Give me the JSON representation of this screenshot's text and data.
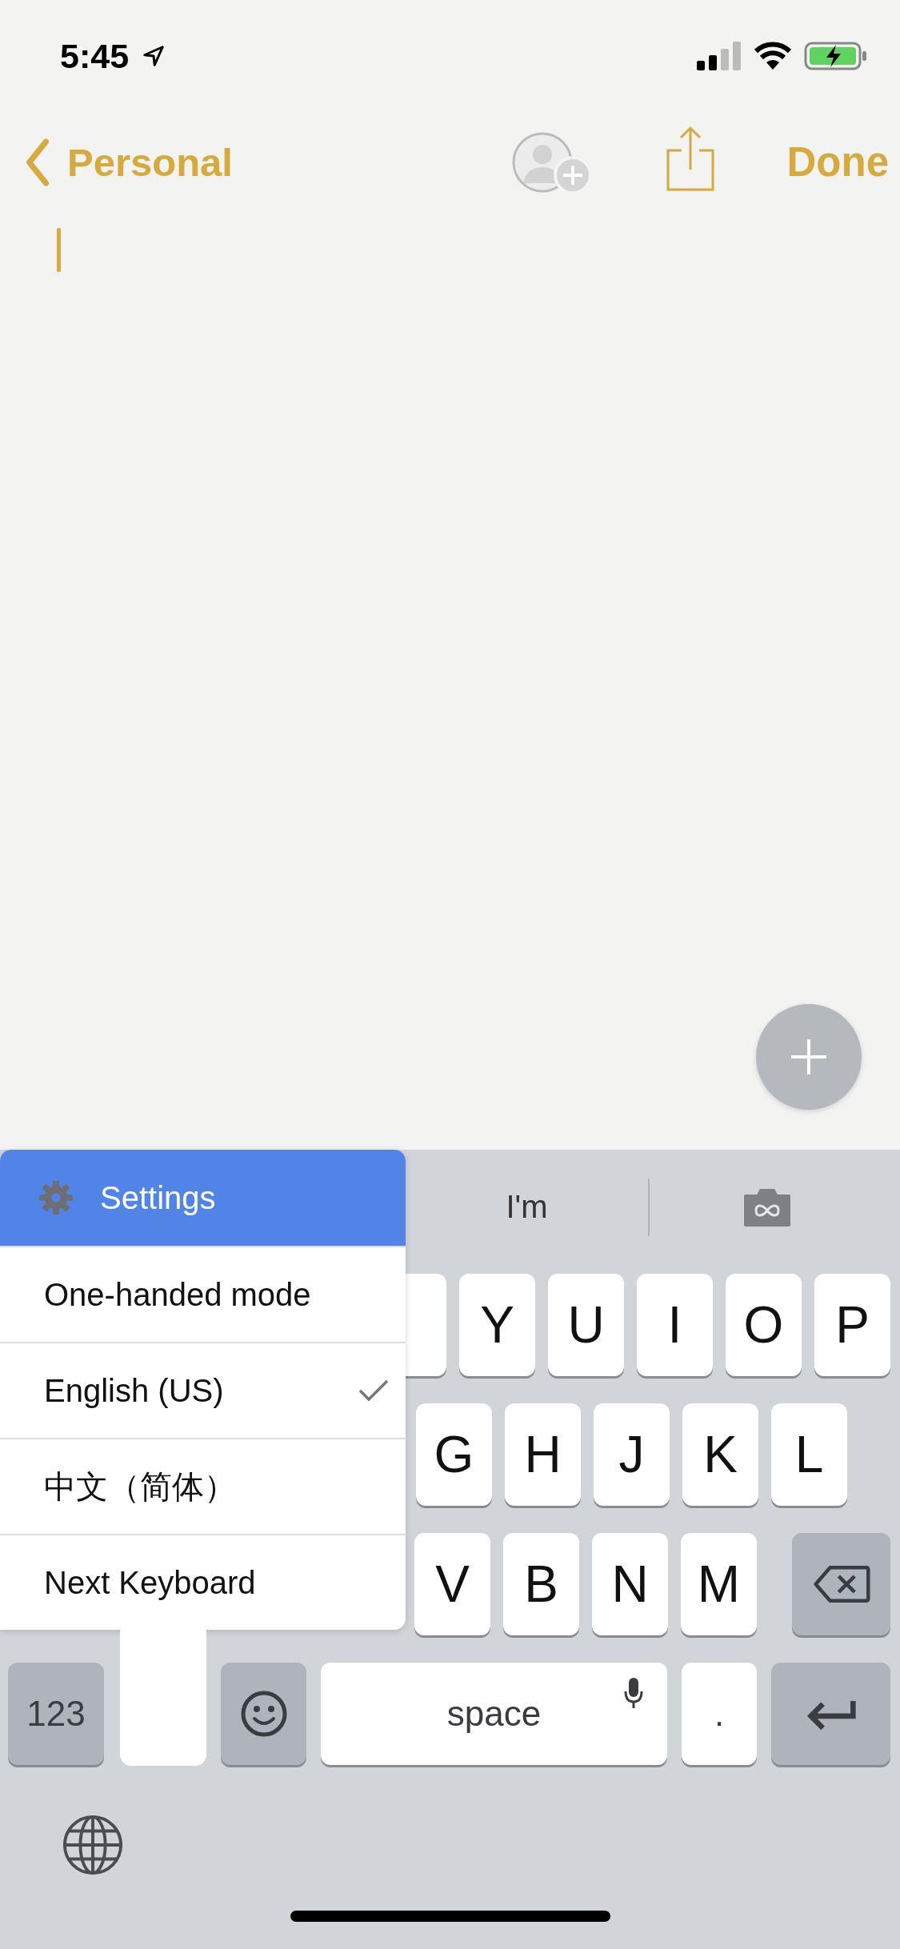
{
  "status_bar": {
    "time": "5:45"
  },
  "nav": {
    "back": "Personal",
    "done": "Done"
  },
  "keyboard": {
    "suggestions": [
      "I'm"
    ],
    "menu": {
      "title": "Settings",
      "items": [
        {
          "label": "One-handed mode",
          "selected": false
        },
        {
          "label": "English (US)",
          "selected": true
        },
        {
          "label": "中文（简体）",
          "selected": false
        },
        {
          "label": "Next Keyboard",
          "selected": false
        }
      ]
    },
    "rows": [
      [
        "Y",
        "U",
        "I",
        "O",
        "P"
      ],
      [
        "G",
        "H",
        "J",
        "K",
        "L"
      ],
      [
        "V",
        "B",
        "N",
        "M"
      ]
    ],
    "bottom": {
      "numbers": "123",
      "space": "space",
      "period": "."
    }
  }
}
